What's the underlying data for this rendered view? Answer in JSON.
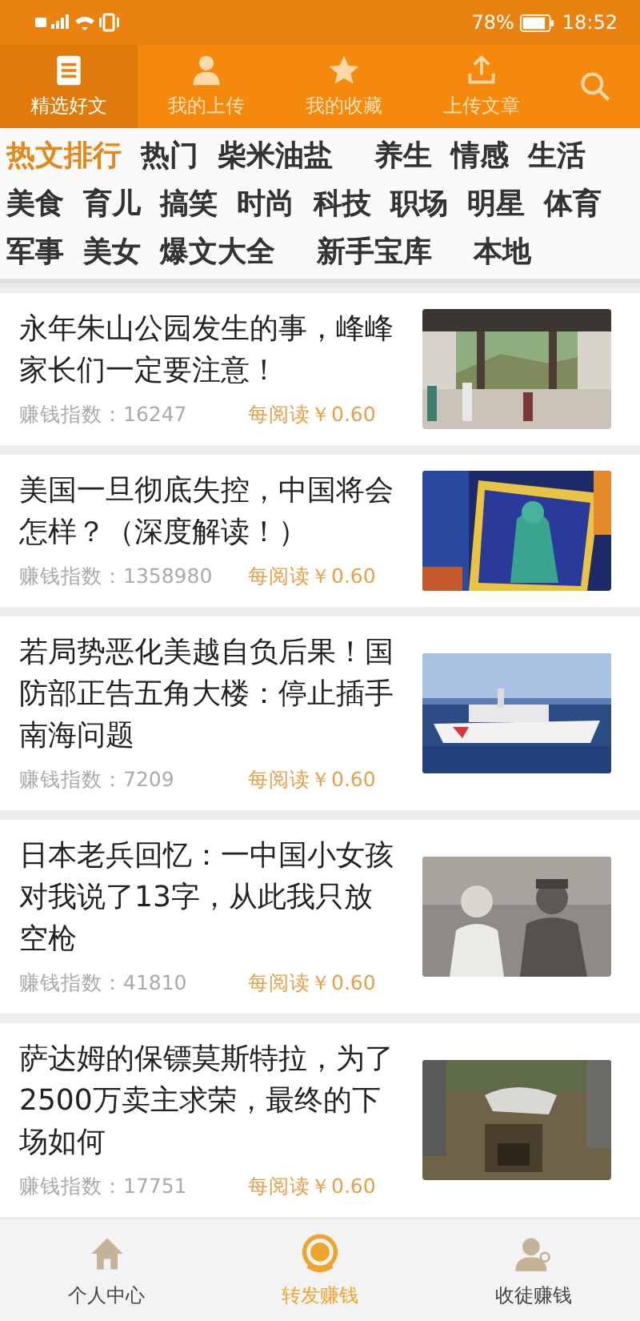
{
  "status_bar": {
    "battery": "78%",
    "time": "18:52"
  },
  "top_tabs": [
    {
      "label": "精选好文",
      "selected": true
    },
    {
      "label": "我的上传",
      "selected": false
    },
    {
      "label": "我的收藏",
      "selected": false
    },
    {
      "label": "上传文章",
      "selected": false
    }
  ],
  "categories": [
    {
      "label": "热文排行",
      "selected": true
    },
    {
      "label": "热门",
      "selected": false
    },
    {
      "label": "柴米油盐",
      "selected": false
    },
    {
      "label": "养生",
      "selected": false
    },
    {
      "label": "情感",
      "selected": false
    },
    {
      "label": "生活",
      "selected": false
    },
    {
      "label": "美食",
      "selected": false
    },
    {
      "label": "育儿",
      "selected": false
    },
    {
      "label": "搞笑",
      "selected": false
    },
    {
      "label": "时尚",
      "selected": false
    },
    {
      "label": "科技",
      "selected": false
    },
    {
      "label": "职场",
      "selected": false
    },
    {
      "label": "明星",
      "selected": false
    },
    {
      "label": "体育",
      "selected": false
    },
    {
      "label": "军事",
      "selected": false
    },
    {
      "label": "美女",
      "selected": false
    },
    {
      "label": "爆文大全",
      "selected": false
    },
    {
      "label": "新手宝库",
      "selected": false
    },
    {
      "label": "本地",
      "selected": false
    }
  ],
  "articles": [
    {
      "title": "永年朱山公园发生的事，峰峰家长们一定要注意！",
      "index": "赚钱指数：16247",
      "reward": "每阅读￥0.60"
    },
    {
      "title": "美国一旦彻底失控，中国将会怎样？（深度解读！）",
      "index": "赚钱指数：1358980",
      "reward": "每阅读￥0.60"
    },
    {
      "title": "若局势恶化美越自负后果！国防部正告五角大楼：停止插手南海问题",
      "index": "赚钱指数：7209",
      "reward": "每阅读￥0.60"
    },
    {
      "title": "日本老兵回忆：一中国小女孩对我说了13字，从此我只放空枪",
      "index": "赚钱指数：41810",
      "reward": "每阅读￥0.60"
    },
    {
      "title": "萨达姆的保镖莫斯特拉，为了2500万卖主求荣，最终的下场如何",
      "index": "赚钱指数：17751",
      "reward": "每阅读￥0.60"
    }
  ],
  "bottom_nav": [
    {
      "label": "个人中心",
      "selected": false
    },
    {
      "label": "转发赚钱",
      "selected": true
    },
    {
      "label": "收徒赚钱",
      "selected": false
    }
  ]
}
